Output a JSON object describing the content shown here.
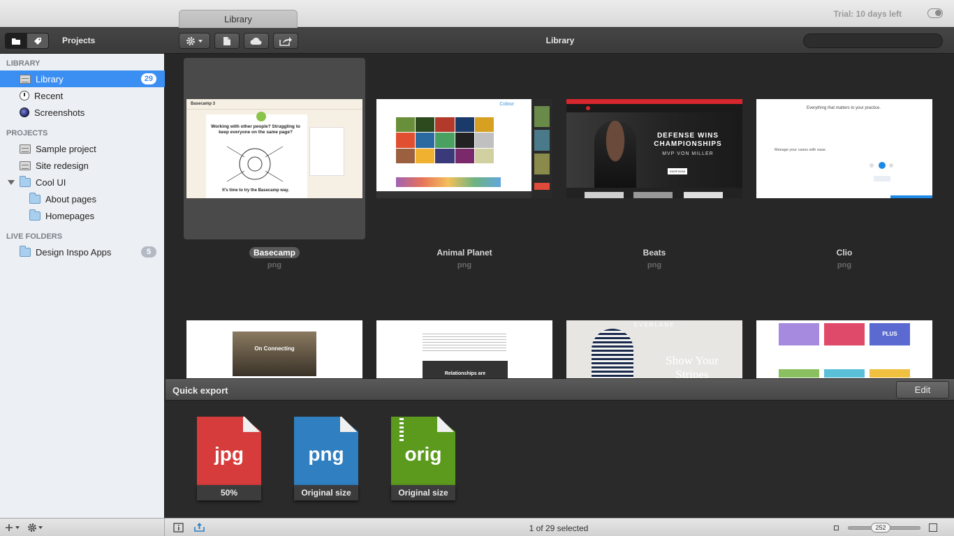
{
  "titlebar": {
    "tab_title": "Library",
    "trial_text": "Trial: 10 days left"
  },
  "toolbar": {
    "projects_label": "Projects",
    "title": "Library",
    "search_placeholder": ""
  },
  "sidebar": {
    "library_header": "LIBRARY",
    "library_items": [
      {
        "label": "Library",
        "badge": "29",
        "icon": "drawer-icon",
        "selected": true
      },
      {
        "label": "Recent",
        "icon": "clock-icon"
      },
      {
        "label": "Screenshots",
        "icon": "lens-icon"
      }
    ],
    "projects_header": "PROJECTS",
    "project_items": [
      {
        "label": "Sample project",
        "icon": "drawer-icon"
      },
      {
        "label": "Site redesign",
        "icon": "drawer-icon"
      },
      {
        "label": "Cool UI",
        "icon": "folder-icon",
        "expanded": true
      },
      {
        "label": "About pages",
        "icon": "folder-icon",
        "child": true
      },
      {
        "label": "Homepages",
        "icon": "folder-icon",
        "child": true
      }
    ],
    "live_header": "LIVE FOLDERS",
    "live_items": [
      {
        "label": "Design Inspo Apps",
        "badge": "5",
        "icon": "smart-folder-icon"
      }
    ]
  },
  "grid": {
    "items": [
      {
        "name": "Basecamp",
        "type": "png",
        "selected": true
      },
      {
        "name": "Animal Planet",
        "type": "png"
      },
      {
        "name": "Beats",
        "type": "png"
      },
      {
        "name": "Clio",
        "type": "png"
      }
    ],
    "previews": {
      "basecamp_logo": "Basecamp 3",
      "basecamp_headline": "Working with other people? Struggling to keep everyone on the same page?",
      "basecamp_sub": "It's time to try the Basecamp way.",
      "animal_colour": "Colour",
      "beats_headline": "DEFENSE WINS CHAMPIONSHIPS",
      "beats_sub": "MVP VON MILLER",
      "beats_cta": "SHOP NOW",
      "clio_headline": "Everything that matters to your practice.",
      "clio_sub": "Manage your cases with ease.",
      "on_connecting": "On Connecting",
      "relationships": "Relationships are",
      "everlane": "EVERLANE",
      "show_stripes": "Show Your Stripes",
      "plus": "PLUS"
    }
  },
  "quick_export": {
    "title": "Quick export",
    "edit_label": "Edit",
    "presets": [
      {
        "ext": "jpg",
        "caption": "50%",
        "color": "#d63c3c"
      },
      {
        "ext": "png",
        "caption": "Original size",
        "color": "#2f7fc1"
      },
      {
        "ext": "orig",
        "caption": "Original size",
        "color": "#5c9a1e"
      }
    ]
  },
  "bottombar": {
    "status": "1 of 29 selected",
    "zoom_value": "252"
  }
}
